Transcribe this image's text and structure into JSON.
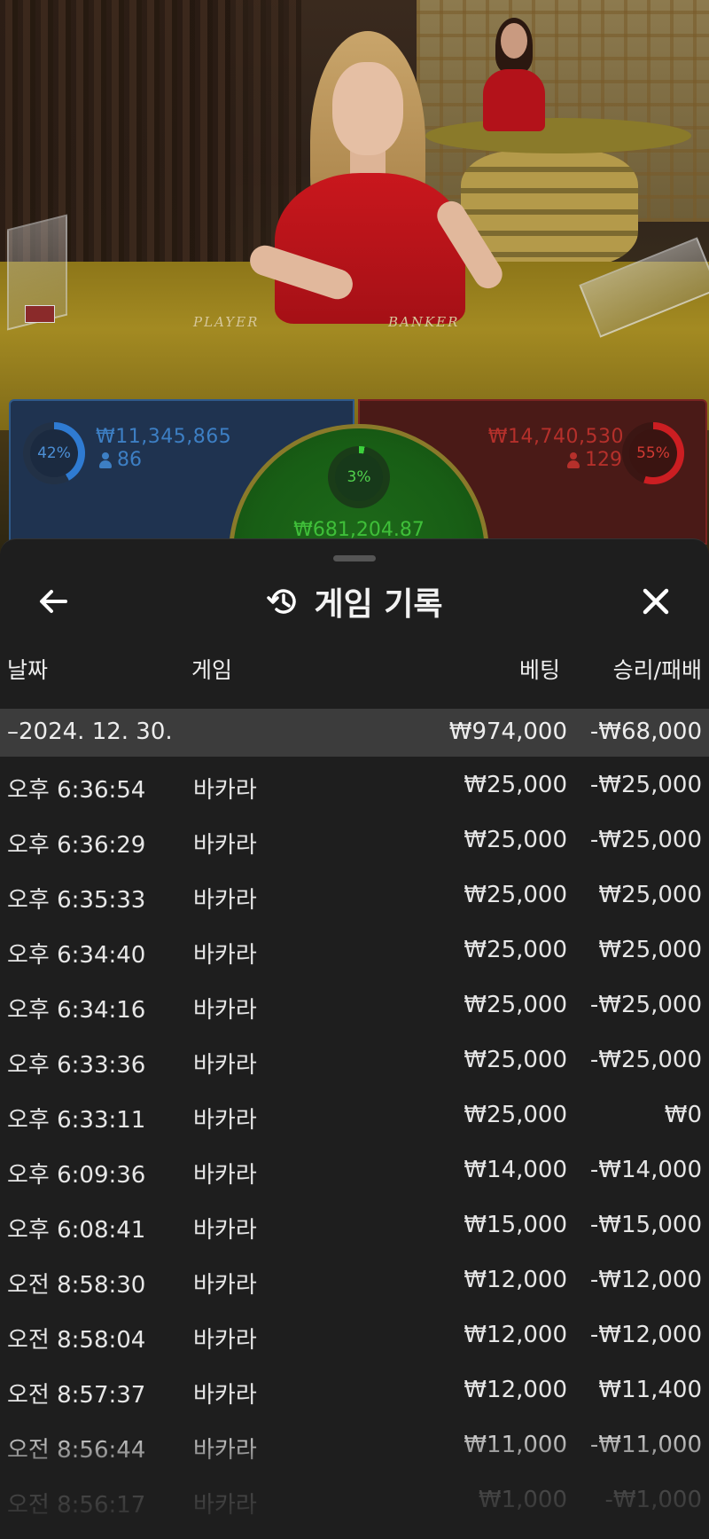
{
  "table": {
    "player_label": "PLAYER",
    "banker_label": "BANKER"
  },
  "bets": {
    "player": {
      "percent_label": "42%",
      "percent": 42,
      "amount": "₩11,345,865",
      "players": "86",
      "color": "#3d7fc4"
    },
    "tie": {
      "percent_label": "3%",
      "percent": 3,
      "amount": "₩681,204.87",
      "color": "#3fbf39"
    },
    "banker": {
      "percent_label": "55%",
      "percent": 55,
      "amount": "₩14,740,530",
      "players": "129",
      "color": "#b5302b"
    }
  },
  "sheet": {
    "title": "게임 기록",
    "back_icon": "arrow-left-icon",
    "history_icon": "history-icon",
    "close_icon": "close-icon",
    "columns": {
      "date": "날짜",
      "game": "게임",
      "bet": "베팅",
      "result": "승리/패배"
    },
    "date_group": {
      "date": "–2024. 12. 30.",
      "bet_total": "₩974,000",
      "result_total": "-₩68,000"
    },
    "rows": [
      {
        "time": "오후 6:36:54",
        "game": "바카라",
        "bet": "₩25,000",
        "result": "-₩25,000"
      },
      {
        "time": "오후 6:36:29",
        "game": "바카라",
        "bet": "₩25,000",
        "result": "-₩25,000"
      },
      {
        "time": "오후 6:35:33",
        "game": "바카라",
        "bet": "₩25,000",
        "result": "₩25,000"
      },
      {
        "time": "오후 6:34:40",
        "game": "바카라",
        "bet": "₩25,000",
        "result": "₩25,000"
      },
      {
        "time": "오후 6:34:16",
        "game": "바카라",
        "bet": "₩25,000",
        "result": "-₩25,000"
      },
      {
        "time": "오후 6:33:36",
        "game": "바카라",
        "bet": "₩25,000",
        "result": "-₩25,000"
      },
      {
        "time": "오후 6:33:11",
        "game": "바카라",
        "bet": "₩25,000",
        "result": "₩0"
      },
      {
        "time": "오후 6:09:36",
        "game": "바카라",
        "bet": "₩14,000",
        "result": "-₩14,000"
      },
      {
        "time": "오후 6:08:41",
        "game": "바카라",
        "bet": "₩15,000",
        "result": "-₩15,000"
      },
      {
        "time": "오전 8:58:30",
        "game": "바카라",
        "bet": "₩12,000",
        "result": "-₩12,000"
      },
      {
        "time": "오전 8:58:04",
        "game": "바카라",
        "bet": "₩12,000",
        "result": "-₩12,000"
      },
      {
        "time": "오전 8:57:37",
        "game": "바카라",
        "bet": "₩12,000",
        "result": "₩11,400"
      },
      {
        "time": "오전 8:56:44",
        "game": "바카라",
        "bet": "₩11,000",
        "result": "-₩11,000"
      },
      {
        "time": "오전 8:56:17",
        "game": "바카라",
        "bet": "₩1,000",
        "result": "-₩1,000"
      }
    ]
  }
}
